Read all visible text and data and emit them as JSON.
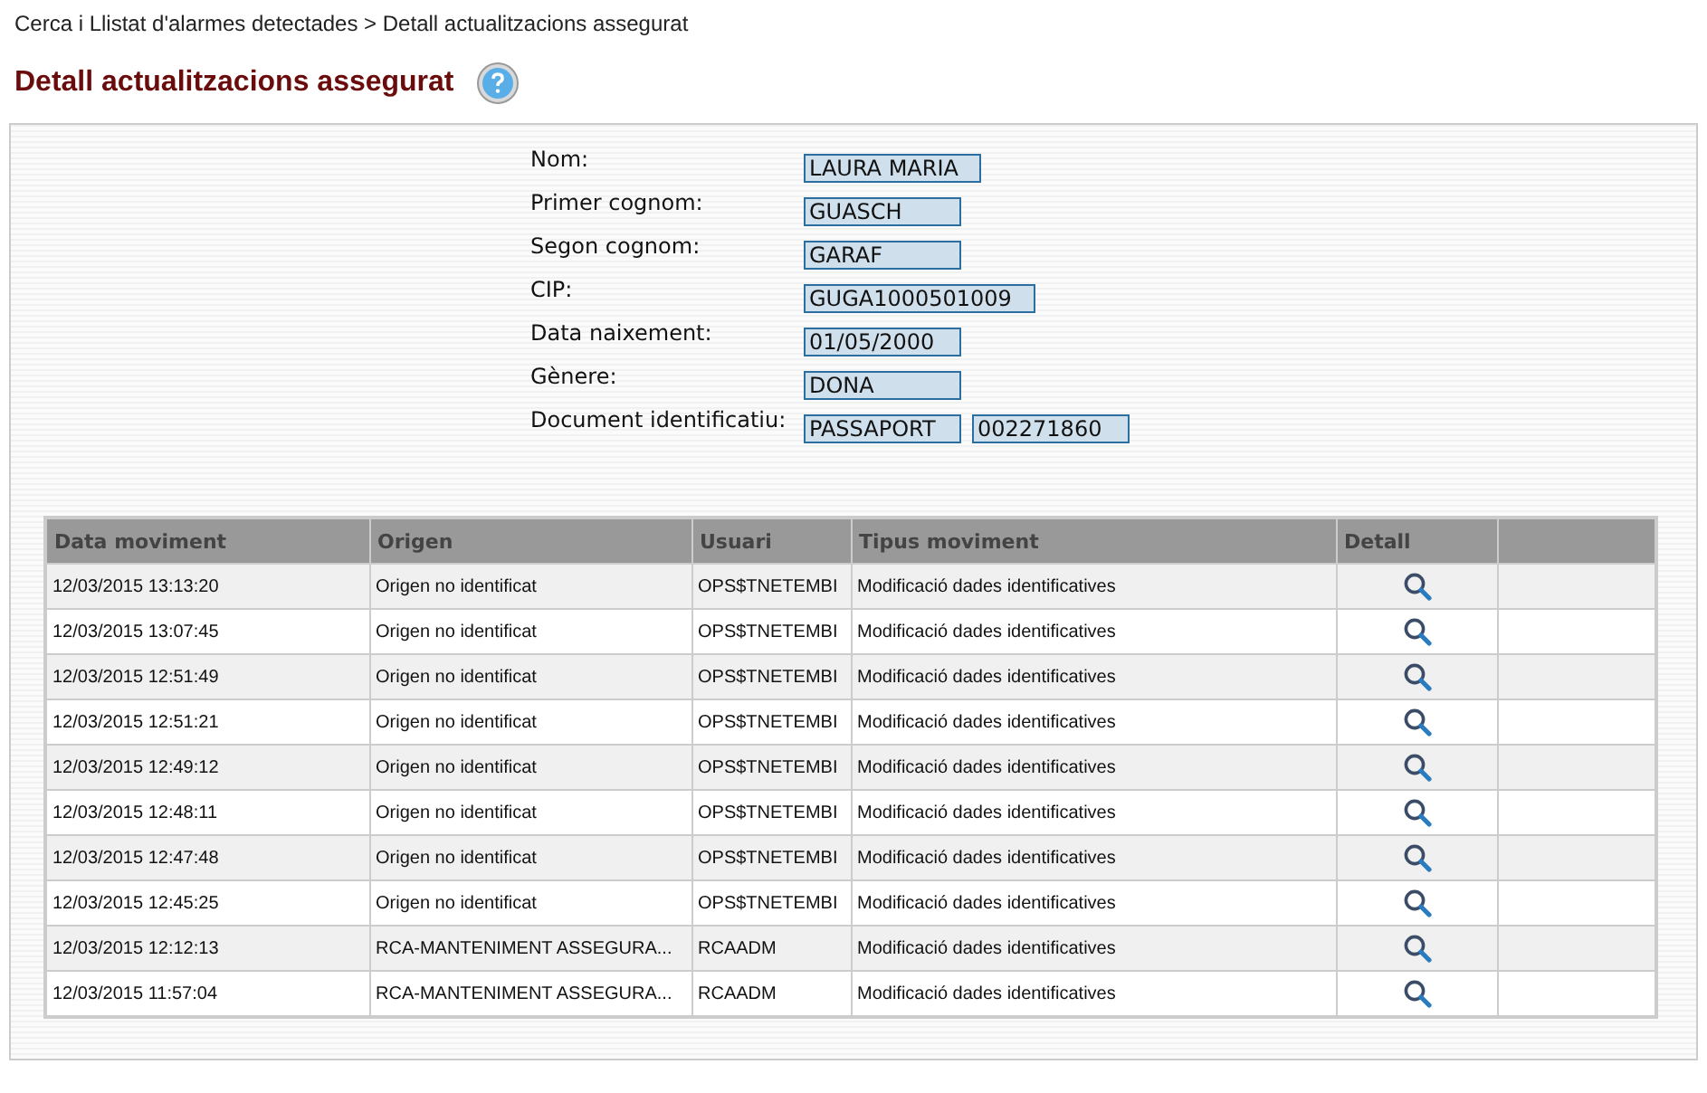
{
  "breadcrumb": "Cerca i Llistat d'alarmes detectades > Detall actualitzacions assegurat",
  "title": "Detall actualitzacions assegurat",
  "form": [
    {
      "label": "Nom:",
      "values": [
        "LAURA MARIA"
      ]
    },
    {
      "label": "Primer cognom:",
      "values": [
        "GUASCH"
      ]
    },
    {
      "label": "Segon cognom:",
      "values": [
        "GARAF"
      ]
    },
    {
      "label": "CIP:",
      "values": [
        "GUGA1000501009"
      ]
    },
    {
      "label": "Data naixement:",
      "values": [
        "01/05/2000"
      ]
    },
    {
      "label": "Gènere:",
      "values": [
        "DONA"
      ]
    },
    {
      "label": "Document identificatiu:",
      "values": [
        "PASSAPORT",
        "002271860"
      ]
    }
  ],
  "table": {
    "columns": [
      "Data moviment",
      "Origen",
      "Usuari",
      "Tipus moviment",
      "Detall"
    ],
    "rows": [
      {
        "date": "12/03/2015 13:13:20",
        "origin": "Origen no identificat",
        "user": "OPS$TNETEMBI",
        "type": "Modificació dades identificatives"
      },
      {
        "date": "12/03/2015 13:07:45",
        "origin": "Origen no identificat",
        "user": "OPS$TNETEMBI",
        "type": "Modificació dades identificatives"
      },
      {
        "date": "12/03/2015 12:51:49",
        "origin": "Origen no identificat",
        "user": "OPS$TNETEMBI",
        "type": "Modificació dades identificatives"
      },
      {
        "date": "12/03/2015 12:51:21",
        "origin": "Origen no identificat",
        "user": "OPS$TNETEMBI",
        "type": "Modificació dades identificatives"
      },
      {
        "date": "12/03/2015 12:49:12",
        "origin": "Origen no identificat",
        "user": "OPS$TNETEMBI",
        "type": "Modificació dades identificatives"
      },
      {
        "date": "12/03/2015 12:48:11",
        "origin": "Origen no identificat",
        "user": "OPS$TNETEMBI",
        "type": "Modificació dades identificatives"
      },
      {
        "date": "12/03/2015 12:47:48",
        "origin": "Origen no identificat",
        "user": "OPS$TNETEMBI",
        "type": "Modificació dades identificatives"
      },
      {
        "date": "12/03/2015 12:45:25",
        "origin": "Origen no identificat",
        "user": "OPS$TNETEMBI",
        "type": "Modificació dades identificatives"
      },
      {
        "date": "12/03/2015 12:12:13",
        "origin": "RCA-MANTENIMENT ASSEGURA...",
        "user": "RCAADM",
        "type": "Modificació dades identificatives"
      },
      {
        "date": "12/03/2015 11:57:04",
        "origin": "RCA-MANTENIMENT ASSEGURA...",
        "user": "RCAADM",
        "type": "Modificació dades identificatives"
      }
    ]
  }
}
